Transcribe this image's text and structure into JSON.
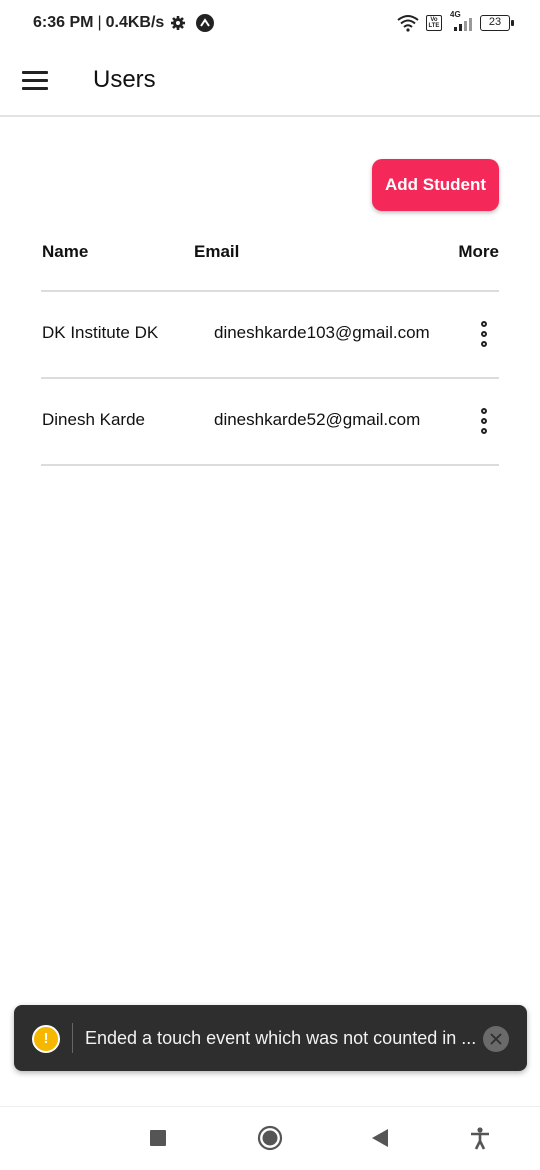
{
  "status_bar": {
    "time": "6:36 PM",
    "separator": "|",
    "speed": "0.4KB/s",
    "network": "4G",
    "volte": "Vo LTE",
    "battery": "23"
  },
  "app_bar": {
    "title": "Users"
  },
  "actions": {
    "add_student_label": "Add Student",
    "accent_color": "#f5285a"
  },
  "table": {
    "headers": {
      "name": "Name",
      "email": "Email",
      "more": "More"
    },
    "rows": [
      {
        "name": "DK Institute DK",
        "email": "dineshkarde103@gmail.com"
      },
      {
        "name": "Dinesh Karde",
        "email": "dineshkarde52@gmail.com"
      }
    ]
  },
  "toast": {
    "message": "Ended a touch event which was not counted in ...",
    "icon": "warning-icon",
    "icon_glyph": "!",
    "background": "#2e2e2e"
  },
  "nav_bar": {
    "icons": [
      "recents-square-icon",
      "home-circle-icon",
      "back-triangle-icon",
      "accessibility-icon"
    ]
  }
}
